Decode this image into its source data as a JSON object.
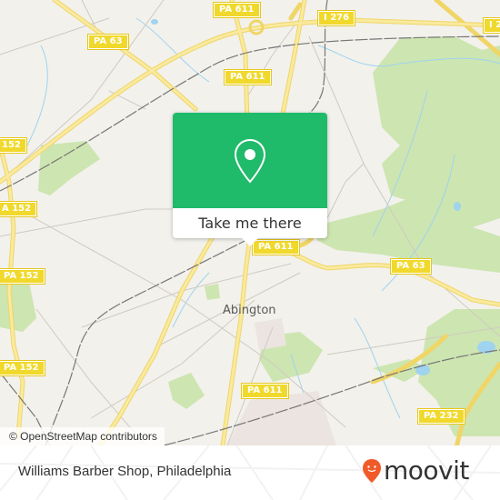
{
  "map": {
    "attribution": "© OpenStreetMap contributors",
    "colors": {
      "background": "#f2f1ec",
      "road_major": "#f7e27a",
      "road_minor": "#cfcac2",
      "park": "#cde5b0",
      "water": "#9fd3ef",
      "rail": "#777777",
      "shield": "#f0d92c"
    },
    "road_shields": [
      {
        "id": "pa611-top",
        "label": "PA 611"
      },
      {
        "id": "i276-top",
        "label": "I 276"
      },
      {
        "id": "i276-right",
        "label": "I 2"
      },
      {
        "id": "pa63-left",
        "label": "PA 63"
      },
      {
        "id": "pa611-upper",
        "label": "PA 611"
      },
      {
        "id": "pa152-a",
        "label": "152"
      },
      {
        "id": "pa152-b",
        "label": "A 152"
      },
      {
        "id": "pa611-center",
        "label": "PA 611"
      },
      {
        "id": "pa63-right",
        "label": "PA 63"
      },
      {
        "id": "pa152-c",
        "label": "PA 152"
      },
      {
        "id": "pa152-d",
        "label": "PA 152"
      },
      {
        "id": "pa611-lower",
        "label": "PA 611"
      },
      {
        "id": "pa232",
        "label": "PA 232"
      }
    ],
    "places": [
      {
        "id": "abington",
        "label": "Abington"
      }
    ]
  },
  "popup": {
    "icon": "map-pin-icon",
    "button_label": "Take me there",
    "accent": "#1fba6a"
  },
  "footer": {
    "place_title": "Williams Barber Shop, Philadelphia",
    "logo": {
      "icon": "moovit-pin-icon",
      "text": "moovit",
      "accent": "#f05a28"
    }
  }
}
